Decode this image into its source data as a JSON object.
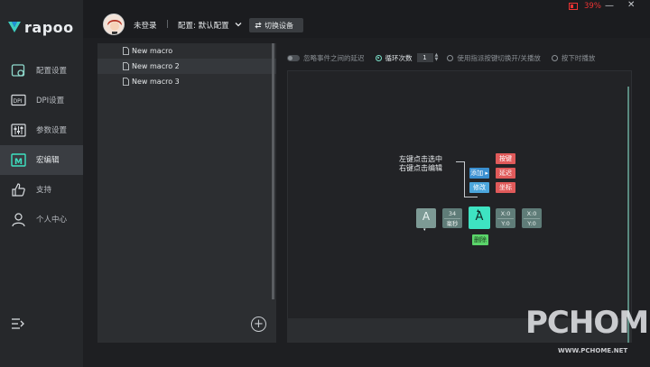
{
  "brand": {
    "name": "rapoo"
  },
  "sidebar": {
    "items": [
      {
        "label": "配置设置",
        "icon": "settings-icon",
        "active": false
      },
      {
        "label": "DPI设置",
        "icon": "dpi-icon",
        "active": false
      },
      {
        "label": "参数设置",
        "icon": "sliders-icon",
        "active": false
      },
      {
        "label": "宏编辑",
        "icon": "macro-icon",
        "active": true
      },
      {
        "label": "支持",
        "icon": "thumbs-up-icon",
        "active": false
      },
      {
        "label": "个人中心",
        "icon": "user-icon",
        "active": false
      }
    ]
  },
  "topbar": {
    "login_status": "未登录",
    "separator": "|",
    "config_label": "配置: 默认配置",
    "switch_device": "切换设备",
    "battery_percent": "39%",
    "minimize": "—",
    "close": "✕"
  },
  "macro_list": {
    "items": [
      "New macro",
      "New macro 2",
      "New macro 3"
    ],
    "add_symbol": "+"
  },
  "options": {
    "ignore_delay": "忽略事件之间的延迟",
    "loop_times": "循环次数",
    "loop_value": "1",
    "toggle_play": "使用指派按键切换开/关播放",
    "hold_play": "按下时播放"
  },
  "editor": {
    "hint_line1": "左键点击选中",
    "hint_line2": "右键点击编辑",
    "btn_add": "添加 ▸",
    "btn_modify": "修改",
    "btn_key": "按键",
    "btn_delay": "延迟",
    "btn_coord": "坐标",
    "btn_delete": "删除",
    "key_start": "A",
    "key_start_arrow": "▾",
    "delay_value": "34",
    "delay_unit": "毫秒",
    "key_active": "A",
    "key_active_arrow": "▴",
    "coord1_x": "X:0",
    "coord1_y": "Y:0",
    "coord2_x": "X:0",
    "coord2_y": "Y:0"
  },
  "watermark": {
    "main": "PCHOME",
    "sub": "WWW.PCHOME.NET"
  },
  "colors": {
    "accent_teal": "#3ee3c2",
    "action_blue": "#3a8fd0",
    "action_red": "#e05a5a",
    "delete_green": "#5bd46a",
    "battery_red": "#e33333"
  }
}
